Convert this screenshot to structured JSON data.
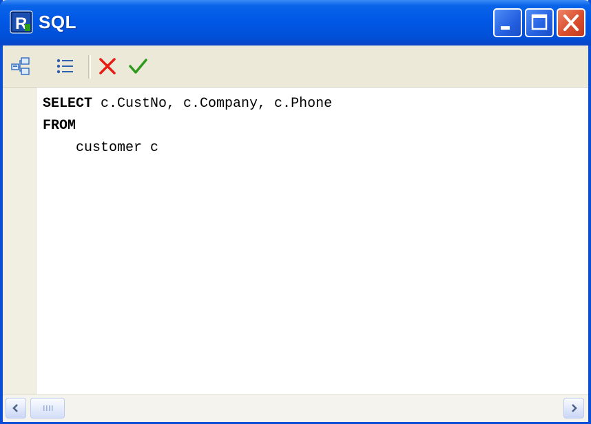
{
  "window": {
    "title": "SQL",
    "icons": {
      "app": "fastreport-app-icon",
      "minimize": "minimize-icon",
      "maximize": "maximize-icon",
      "close": "close-icon"
    },
    "colors": {
      "titlebar": "#0058E6",
      "frame": "#0A4ED8",
      "client": "#ECE9D8",
      "close_button": "#DA4F2E"
    }
  },
  "toolbar": {
    "buttons": [
      {
        "icon": "query-builder-icon"
      },
      {
        "icon": "params-list-icon"
      },
      {
        "icon": "cancel-icon",
        "color": "#E81A12"
      },
      {
        "icon": "ok-check-icon",
        "color": "#2E9A1C"
      }
    ]
  },
  "editor": {
    "lines": [
      {
        "keyword": "SELECT",
        "text": " c.CustNo, c.Company, c.Phone"
      },
      {
        "keyword": "FROM",
        "text": ""
      },
      {
        "keyword": "",
        "text": "    customer c"
      }
    ]
  },
  "scrollbar": {
    "icons": {
      "left": "scroll-left-arrow-icon",
      "thumb": "scroll-thumb-grip-icon",
      "right": "scroll-right-arrow-icon"
    }
  }
}
